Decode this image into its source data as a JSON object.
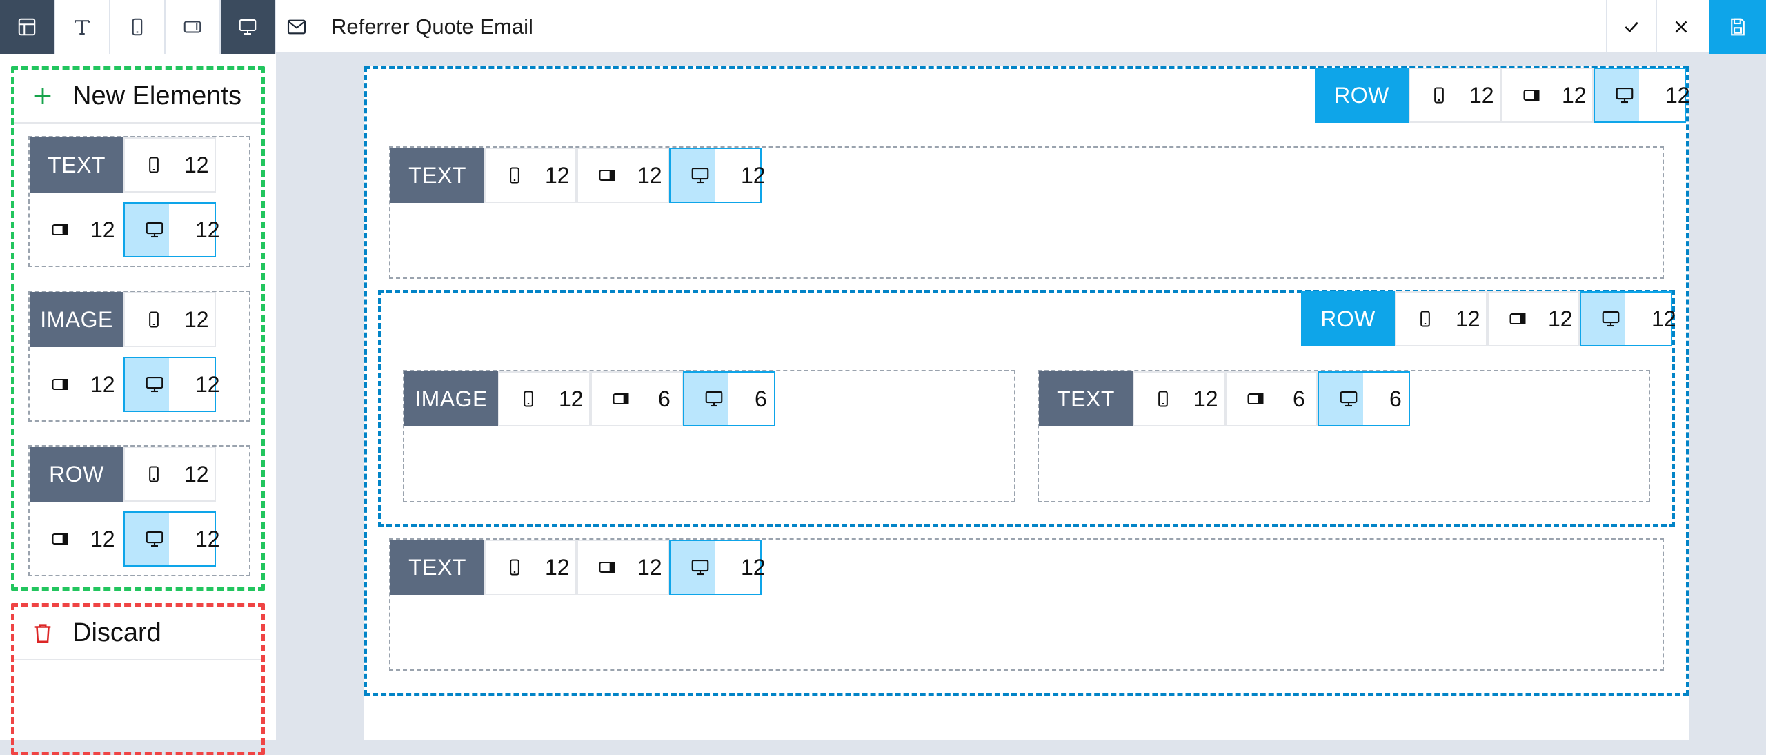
{
  "toolbar": {
    "items": [
      {
        "name": "layout-icon",
        "label": "layout"
      },
      {
        "name": "text-icon",
        "label": "text"
      },
      {
        "name": "mobile-icon",
        "label": "mobile"
      },
      {
        "name": "tablet-icon",
        "label": "tablet"
      },
      {
        "name": "desktop-icon",
        "label": "desktop"
      }
    ],
    "title": "Referrer Quote Email",
    "accent": "#0ea5e9"
  },
  "sidebar": {
    "new_label": "New Elements",
    "discard_label": "Discard",
    "palette": [
      {
        "tag": "TEXT",
        "mobile": "12",
        "tablet": "12",
        "desktop": "12"
      },
      {
        "tag": "IMAGE",
        "mobile": "12",
        "tablet": "12",
        "desktop": "12"
      },
      {
        "tag": "ROW",
        "mobile": "12",
        "tablet": "12",
        "desktop": "12"
      }
    ]
  },
  "canvas": {
    "outer_row": {
      "tag": "ROW",
      "mobile": "12",
      "tablet": "12",
      "desktop": "12"
    },
    "text1": {
      "tag": "TEXT",
      "mobile": "12",
      "tablet": "12",
      "desktop": "12"
    },
    "inner_row": {
      "tag": "ROW",
      "mobile": "12",
      "tablet": "12",
      "desktop": "12"
    },
    "image1": {
      "tag": "IMAGE",
      "mobile": "12",
      "tablet": "6",
      "desktop": "6"
    },
    "text2": {
      "tag": "TEXT",
      "mobile": "12",
      "tablet": "6",
      "desktop": "6"
    },
    "text3": {
      "tag": "TEXT",
      "mobile": "12",
      "tablet": "12",
      "desktop": "12"
    }
  }
}
